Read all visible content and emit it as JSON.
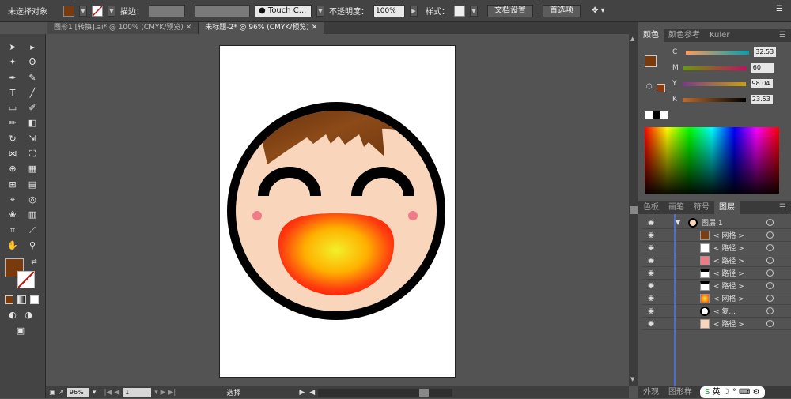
{
  "control_bar": {
    "no_selection": "未选择对象",
    "stroke_label": "描边：",
    "brush_name": "Touch C...",
    "opacity_label": "不透明度：",
    "opacity_value": "100%",
    "style_label": "样式：",
    "doc_setup": "文档设置",
    "preferences": "首选项"
  },
  "tabs": [
    {
      "label": "图形1 [转换].ai* @ 100% (CMYK/预览)"
    },
    {
      "label": "未标题-2* @ 96% (CMYK/预览)"
    }
  ],
  "colors": {
    "fill": "#7a3b0c",
    "face": "#f9d6bb",
    "hair": "#7a3f12",
    "outline": "#000000",
    "cheek": "#f07a86"
  },
  "color_panel": {
    "tabs": [
      "颜色",
      "颜色参考",
      "Kuler"
    ],
    "channels": [
      {
        "name": "C",
        "value": "32.53"
      },
      {
        "name": "M",
        "value": "60"
      },
      {
        "name": "Y",
        "value": "98.04"
      },
      {
        "name": "K",
        "value": "23.53"
      }
    ]
  },
  "layers_panel": {
    "tabs": [
      "色板",
      "画笔",
      "符号",
      "图层"
    ],
    "layer_name": "图层 1",
    "items": [
      "< 网格 >",
      "< 路径 >",
      "< 路径 >",
      "< 路径 >",
      "< 路径 >",
      "< 网格 >",
      "< 复...",
      "< 路径 >"
    ]
  },
  "status": {
    "zoom": "96%",
    "page": "1",
    "mode": "选择"
  },
  "bottom_tabs": [
    "外观",
    "图形样"
  ],
  "ime": "英"
}
